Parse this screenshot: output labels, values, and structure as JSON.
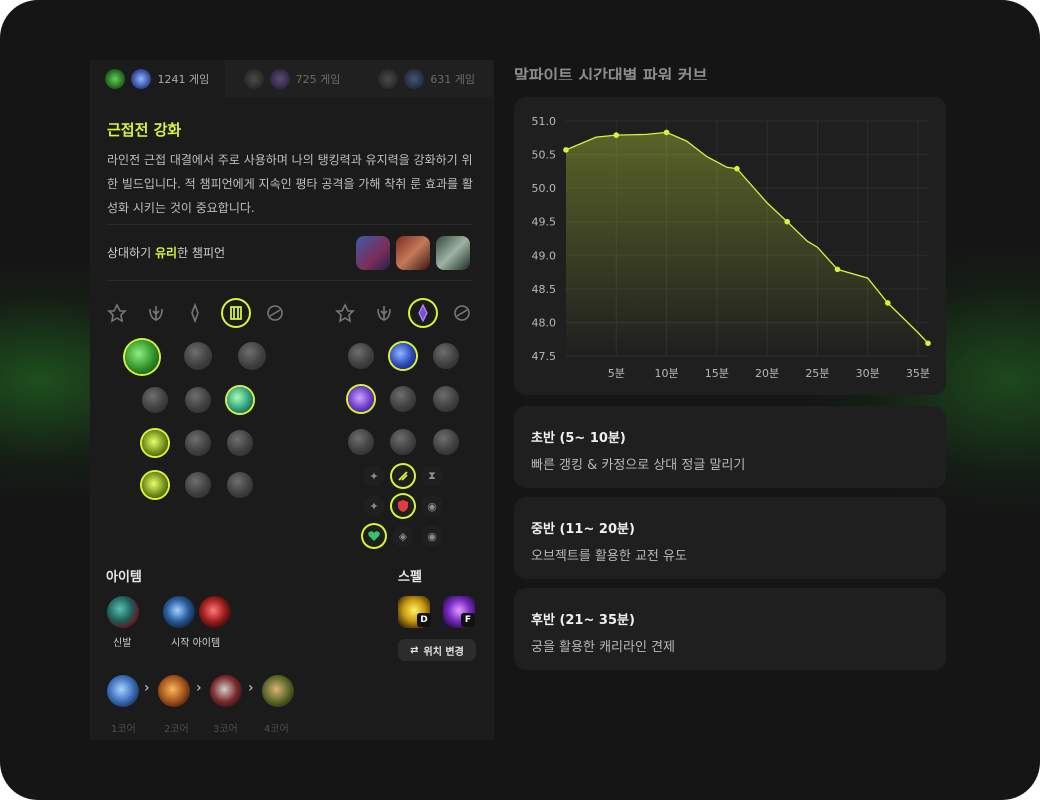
{
  "build_tabs": [
    {
      "games": "1241 게임",
      "active": true
    },
    {
      "games": "725 게임",
      "active": false
    },
    {
      "games": "631 게임",
      "active": false
    }
  ],
  "build": {
    "title": "근접전 강화",
    "description": "라인전 근접 대결에서 주로 사용하며 나의 탱킹력과 유지력을 강화하기 위한 빌드입니다. 적 챔피언에게 지속인 평타 공격을 가해 착취 룬 효과를 활성화 시키는 것이 중요합니다."
  },
  "favorable": {
    "prefix": "상대하기 ",
    "highlight": "유리",
    "suffix": "한 챔피언"
  },
  "items": {
    "section_label": "아이템",
    "boots_caption": "신발",
    "starter_caption": "시작 아이템",
    "cores": [
      "1코어",
      "2코어",
      "3코어",
      "4코어"
    ],
    "arrow": "›"
  },
  "spells": {
    "section_label": "스펠",
    "keys": [
      "D",
      "F"
    ],
    "swap_label": "위치 변경",
    "swap_icon": "⇄"
  },
  "chart_title": "말파이트 시간대별 파워 커브",
  "chart_data": {
    "type": "line",
    "title": "말파이트 시간대별 파워 커브",
    "xlabel": "",
    "ylabel": "",
    "x_ticks": [
      "5분",
      "10분",
      "15분",
      "20분",
      "25분",
      "30분",
      "35분"
    ],
    "y_ticks": [
      "51.0",
      "50.5",
      "50.0",
      "49.5",
      "49.0",
      "48.5",
      "48.0",
      "47.5"
    ],
    "ylim": [
      47.5,
      51.0
    ],
    "xlim": [
      0,
      36
    ],
    "grid": true,
    "line_color": "#d7f43b",
    "x": [
      0,
      3,
      5,
      8,
      10,
      12,
      14,
      16,
      17,
      19,
      20,
      22,
      24,
      25,
      27,
      30,
      32,
      35,
      36
    ],
    "y": [
      50.57,
      50.76,
      50.79,
      50.8,
      50.83,
      50.7,
      50.47,
      50.31,
      50.29,
      49.95,
      49.78,
      49.5,
      49.21,
      49.12,
      48.79,
      48.66,
      48.29,
      47.85,
      47.69
    ],
    "markers": [
      0,
      5,
      10,
      17,
      22,
      27,
      32,
      36
    ]
  },
  "phases": [
    {
      "title": "초반 (5~ 10분)",
      "desc": "빠른 갱킹 & 카정으로 상대 정글 말리기"
    },
    {
      "title": "중반 (11~ 20분)",
      "desc": "오브젝트를 활용한 교전 유도"
    },
    {
      "title": "후반 (21~ 35분)",
      "desc": "궁을 활용한 캐리라인 견제"
    }
  ]
}
